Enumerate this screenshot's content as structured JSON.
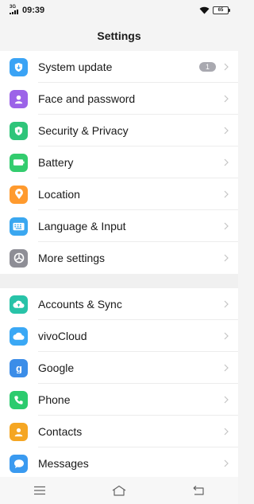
{
  "status_bar": {
    "network": "3G",
    "time": "09:39",
    "battery": "65"
  },
  "header": {
    "title": "Settings"
  },
  "groups": [
    [
      {
        "label": "System update",
        "badge": "1",
        "icon": "system-update-icon",
        "color": "#3aa3f5"
      },
      {
        "label": "Face and password",
        "icon": "face-password-icon",
        "color": "#9c63e8"
      },
      {
        "label": "Security & Privacy",
        "icon": "shield-icon",
        "color": "#2fc57a"
      },
      {
        "label": "Battery",
        "icon": "battery-icon",
        "color": "#33cc6e"
      },
      {
        "label": "Location",
        "icon": "location-pin-icon",
        "color": "#ff9a2e"
      },
      {
        "label": "Language & Input",
        "icon": "keyboard-icon",
        "color": "#3aa7f0"
      },
      {
        "label": "More settings",
        "icon": "gear-icon",
        "color": "#8e8e96"
      }
    ],
    [
      {
        "label": "Accounts & Sync",
        "icon": "cloud-sync-icon",
        "color": "#28c3a8"
      },
      {
        "label": "vivoCloud",
        "icon": "cloud-icon",
        "color": "#3aa8f5"
      },
      {
        "label": "Google",
        "icon": "google-icon",
        "color": "#3b8de8"
      },
      {
        "label": "Phone",
        "icon": "phone-icon",
        "color": "#2ccb6e"
      },
      {
        "label": "Contacts",
        "icon": "contacts-icon",
        "color": "#f5a623"
      },
      {
        "label": "Messages",
        "icon": "message-icon",
        "color": "#3a9af0"
      }
    ]
  ],
  "nav_bar": {
    "items": [
      "menu-icon",
      "home-icon",
      "back-icon"
    ]
  }
}
